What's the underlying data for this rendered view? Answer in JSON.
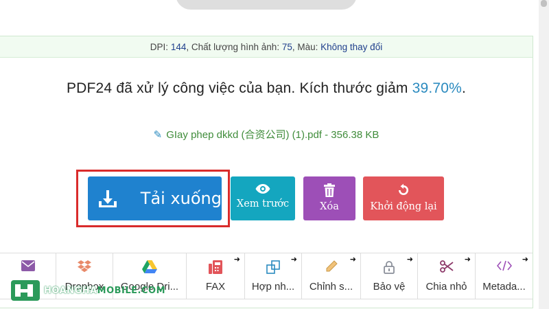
{
  "info": {
    "dpi_label": "DPI: ",
    "dpi_value": "144",
    "quality_label": ", Chất lượng hình ảnh: ",
    "quality_value": "75",
    "color_label": ", Màu: ",
    "color_value": "Không thay đổi"
  },
  "result": {
    "message": "PDF24 đã xử lý công việc của bạn. Kích thước giảm ",
    "percent": "39.70%",
    "suffix": "."
  },
  "file": {
    "label": "GIay phep dkkd (合资公司) (1).pdf - 356.38 KB"
  },
  "actions": {
    "download": "Tải xuống",
    "preview": "Xem trước",
    "delete": "Xóa",
    "restart": "Khởi động lại"
  },
  "tools": [
    {
      "label": "",
      "icon": "mail-icon"
    },
    {
      "label": "Dropbox",
      "icon": "dropbox-icon"
    },
    {
      "label": "Google Dri...",
      "icon": "google-drive-icon"
    },
    {
      "label": "FAX",
      "icon": "fax-icon"
    },
    {
      "label": "Hợp nh...",
      "icon": "merge-icon"
    },
    {
      "label": "Chỉnh s...",
      "icon": "edit-pencil-icon"
    },
    {
      "label": "Bảo vệ",
      "icon": "lock-icon"
    },
    {
      "label": "Chia nhỏ",
      "icon": "scissors-icon"
    },
    {
      "label": "Metada...",
      "icon": "code-icon"
    }
  ],
  "watermark": {
    "part1": "HOANGHA",
    "part2": "MOBILE.COM"
  },
  "colors": {
    "download": "#1f82cf",
    "preview": "#14a6bf",
    "delete": "#9d4fb7",
    "restart": "#e2555a",
    "highlight": "#d92b2b",
    "percent": "#2a8abf",
    "filename": "#3f8c3a"
  }
}
